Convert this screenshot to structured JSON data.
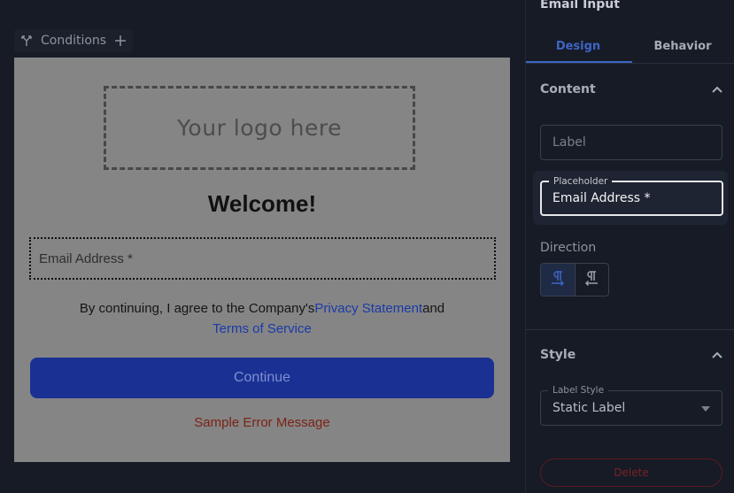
{
  "canvas": {
    "conditions_label": "Conditions",
    "preview": {
      "logo_placeholder": "Your logo here",
      "welcome_title": "Welcome!",
      "email_field_placeholder": "Email Address *",
      "consent_text_prefix": "By continuing, I agree to the Company's",
      "privacy_link": "Privacy Statement",
      "consent_and": "and",
      "terms_link": "Terms of Service",
      "continue_label": "Continue",
      "error_message": "Sample Error Message"
    }
  },
  "panel": {
    "title": "Email Input",
    "tabs": [
      {
        "label": "Design",
        "active": true
      },
      {
        "label": "Behavior",
        "active": false
      }
    ],
    "content_section": {
      "heading": "Content",
      "label_field_placeholder": "Label",
      "placeholder_field_label": "Placeholder",
      "placeholder_field_value": "Email Address *",
      "direction_label": "Direction"
    },
    "style_section": {
      "heading": "Style",
      "label_style_label": "Label Style",
      "label_style_value": "Static Label"
    },
    "delete_label": "Delete"
  },
  "colors": {
    "accent": "#3e64c6",
    "continue_button": "#1a3193",
    "error": "#7c2215",
    "link": "#1a3aa8"
  },
  "icons": [
    "branch-icon",
    "plus-icon",
    "chevron-up-icon",
    "ltr-paragraph-icon",
    "rtl-paragraph-icon",
    "caret-down-icon"
  ]
}
